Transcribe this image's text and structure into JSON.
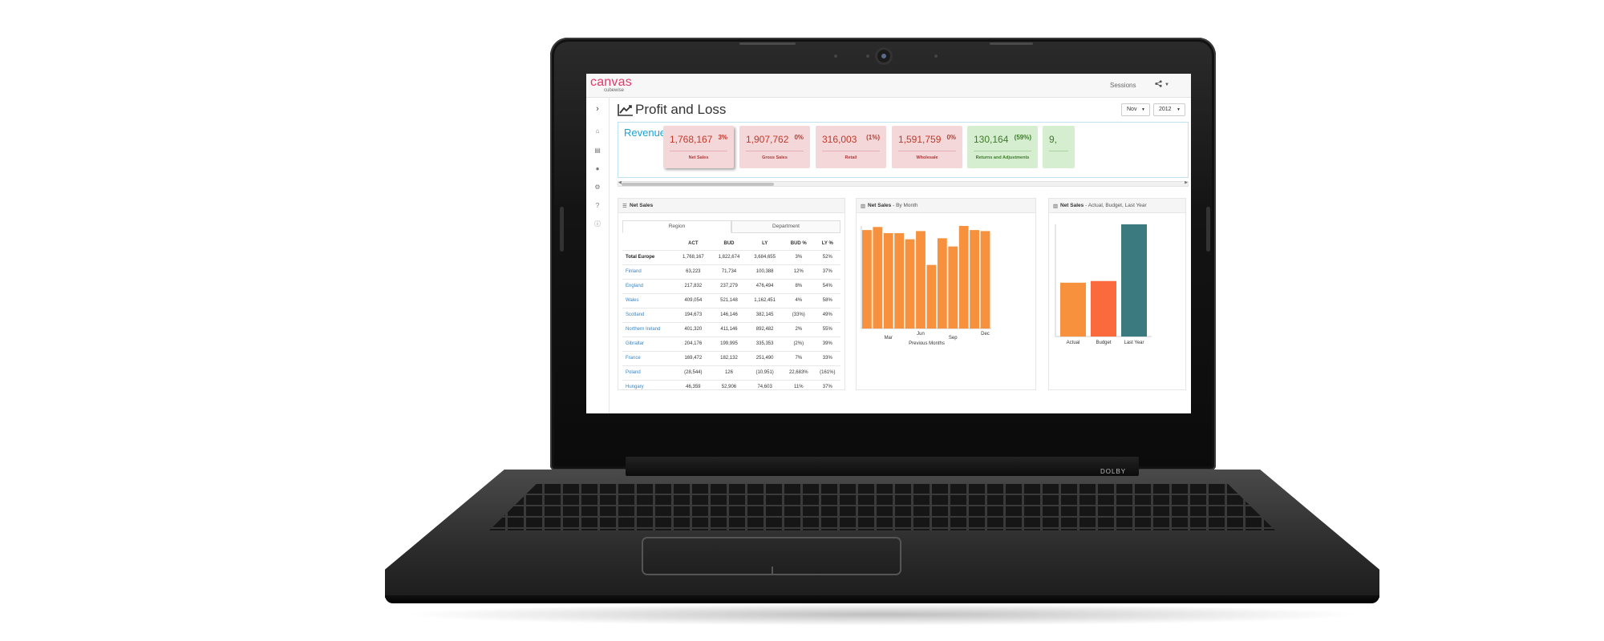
{
  "app": {
    "logo": "canvas",
    "logo_sub": "cubewise",
    "sessions_label": "Sessions",
    "share_icon": "share-icon"
  },
  "header": {
    "title": "Profit and Loss",
    "month": "Nov",
    "year": "2012"
  },
  "sidebar": {
    "icons": [
      "chevron-right-icon",
      "home-icon",
      "document-icon",
      "globe-icon",
      "cogs-icon",
      "help-icon",
      "info-icon"
    ]
  },
  "device": {
    "dolby": "DOLBY"
  },
  "revenue": {
    "label": "Revenue",
    "kpis": [
      {
        "value": "1,768,167",
        "pct": "3%",
        "label": "Net Sales",
        "status": "red"
      },
      {
        "value": "1,907,762",
        "pct": "0%",
        "label": "Gross Sales",
        "status": "red"
      },
      {
        "value": "316,003",
        "pct": "(1%)",
        "label": "Retail",
        "status": "red"
      },
      {
        "value": "1,591,759",
        "pct": "0%",
        "label": "Wholesale",
        "status": "red"
      },
      {
        "value": "130,164",
        "pct": "(59%)",
        "label": "Returns and Adjustments",
        "status": "green"
      },
      {
        "value": "9,",
        "pct": "",
        "label": "",
        "status": "green"
      }
    ]
  },
  "net_sales_table": {
    "title": "Net Sales",
    "tabs": [
      "Region",
      "Department"
    ],
    "columns": [
      "",
      "ACT",
      "BUD",
      "LY",
      "BUD %",
      "LY %"
    ],
    "rows": [
      [
        "Total Europe",
        "1,768,167",
        "1,822,674",
        "3,684,655",
        "3%",
        "52%"
      ],
      [
        "Finland",
        "63,223",
        "71,734",
        "100,388",
        "12%",
        "37%"
      ],
      [
        "England",
        "217,832",
        "237,279",
        "476,494",
        "8%",
        "54%"
      ],
      [
        "Wales",
        "409,054",
        "521,148",
        "1,162,451",
        "4%",
        "58%"
      ],
      [
        "Scotland",
        "194,673",
        "146,146",
        "382,145",
        "(33%)",
        "49%"
      ],
      [
        "Northern Ireland",
        "401,320",
        "411,146",
        "892,482",
        "2%",
        "55%"
      ],
      [
        "Gibraltar",
        "204,176",
        "199,995",
        "335,353",
        "(2%)",
        "39%"
      ],
      [
        "France",
        "169,472",
        "182,132",
        "251,490",
        "7%",
        "33%"
      ],
      [
        "Poland",
        "(28,544)",
        "126",
        "(10,951)",
        "22,683%",
        "(161%)"
      ],
      [
        "Hungary",
        "46,359",
        "52,906",
        "74,603",
        "11%",
        "37%"
      ]
    ]
  },
  "chart_data": [
    {
      "type": "bar",
      "title": "Net Sales",
      "subtitle": "By Month",
      "xlabel": "Previous Months",
      "categories": [
        "",
        "",
        "Mar",
        "",
        "",
        "Jun",
        "",
        "",
        "Sep",
        "",
        "",
        "Dec"
      ],
      "values": [
        96,
        99,
        93,
        93,
        87,
        95,
        62,
        88,
        80,
        100,
        96,
        95
      ],
      "ylim": [
        0,
        100
      ],
      "color": "#f7913d",
      "grid": false
    },
    {
      "type": "bar",
      "title": "Net Sales",
      "subtitle": "Actual, Budget, Last Year",
      "categories": [
        "Actual",
        "Budget",
        "Last Year"
      ],
      "values": [
        1768167,
        1822674,
        3684655
      ],
      "ylim": [
        0,
        3684655
      ],
      "colors": [
        "#f7913d",
        "#fb6a3c",
        "#3b7a7e"
      ],
      "grid": false
    }
  ]
}
